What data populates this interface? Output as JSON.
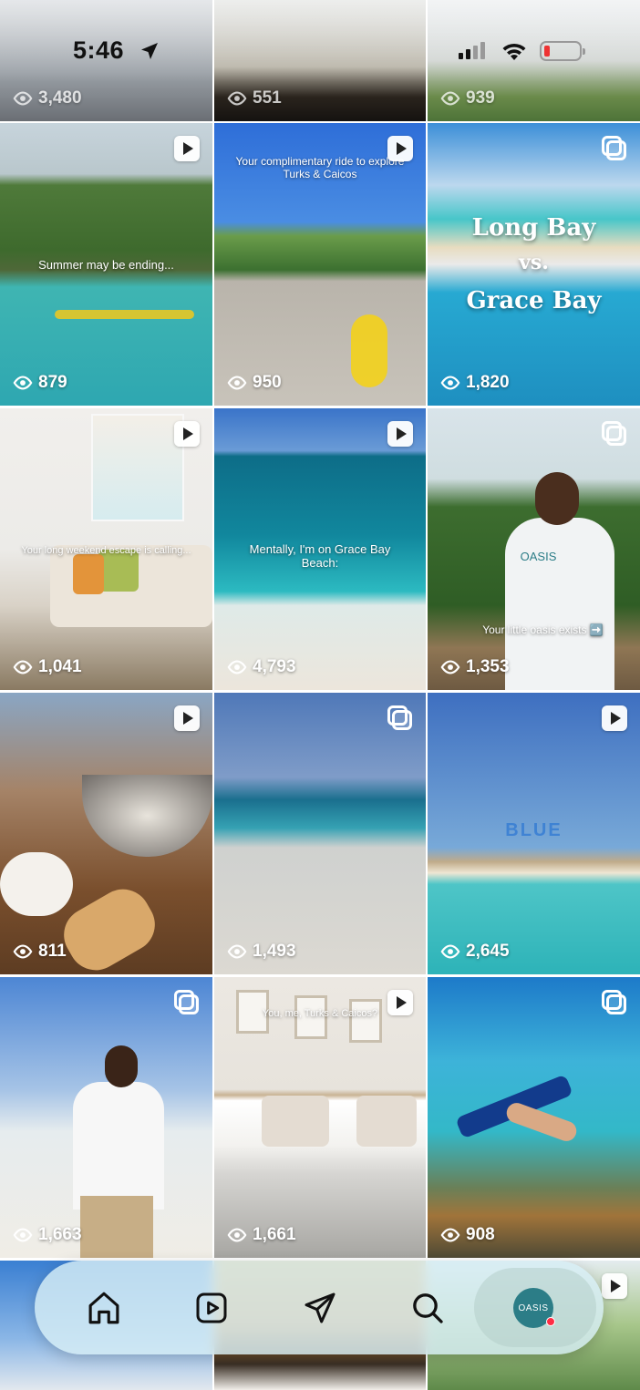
{
  "status_bar": {
    "time": "5:46"
  },
  "top_row": [
    {
      "views": "3,480"
    },
    {
      "views": "551"
    },
    {
      "views": "939"
    }
  ],
  "posts": [
    {
      "views": "879",
      "caption": "Summer may be ending...",
      "badge": "reel"
    },
    {
      "views": "950",
      "caption": "Your complimentary ride to explore Turks & Caicos",
      "badge": "reel"
    },
    {
      "views": "1,820",
      "title_1": "Long Bay",
      "title_2": "vs.",
      "title_3": "Grace Bay",
      "badge": "carousel"
    },
    {
      "views": "1,041",
      "caption": "Your long weekend escape is calling...",
      "badge": "reel"
    },
    {
      "views": "4,793",
      "caption": "Mentally, I'm on Grace Bay Beach:",
      "badge": "reel"
    },
    {
      "views": "1,353",
      "caption": "Your little oasis exists ➡️",
      "shirt_text": "OASIS",
      "badge": "carousel"
    },
    {
      "views": "811",
      "badge": "reel"
    },
    {
      "views": "1,493",
      "badge": "carousel"
    },
    {
      "views": "2,645",
      "watermark": "BLUE",
      "badge": "reel"
    },
    {
      "views": "1,663",
      "badge": "carousel"
    },
    {
      "views": "1,661",
      "caption": "You, me, Turks & Caicos?",
      "badge": "reel"
    },
    {
      "views": "908",
      "badge": "carousel"
    }
  ],
  "nav": {
    "avatar_text": "OASIS",
    "icons": [
      "home-icon",
      "reels-icon",
      "send-icon",
      "search-icon"
    ]
  }
}
